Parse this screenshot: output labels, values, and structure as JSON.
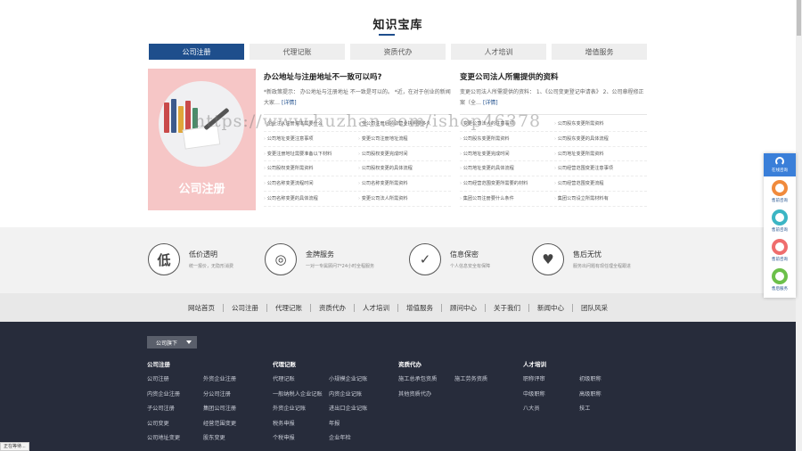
{
  "section": {
    "title": "知识宝库"
  },
  "tabs": [
    {
      "label": "公司注册",
      "active": true
    },
    {
      "label": "代理记账",
      "active": false
    },
    {
      "label": "资质代办",
      "active": false
    },
    {
      "label": "人才培训",
      "active": false
    },
    {
      "label": "增值服务",
      "active": false
    }
  ],
  "hero": {
    "label": "公司注册"
  },
  "articles": [
    {
      "title": "办公地址与注册地址不一致可以吗?",
      "summary": "*新政策提示： 办公地址与注册地址 不一致是可以的。 *近，在对于创业的新闻大家…",
      "more": "[详情]",
      "links": [
        "企业注入注册资本需要什么",
        "全公司注册后领取营业执照要多久",
        "公司地址变更注意事项",
        "变更公司注册地址流程",
        "变更注册地址需要准备以下材料",
        "公司股权变更完成时间",
        "公司股权变更所需资料",
        "公司股权变更的具体流程",
        "公司名称变更流程时间",
        "公司名称变更所需资料",
        "公司名称变更的具体流程",
        "变更公司法人所需资料"
      ]
    },
    {
      "title": "变更公司法人所需提供的资料",
      "summary": "变更公司法人所需提供的资料： 1、《公司变更登记申请表》 2、公司章程修正案（全…",
      "more": "[详情]",
      "links": [
        "变更公司法人的注意事项",
        "公司股东变更所需资料",
        "公司股东变更所需资料",
        "公司股东变更的具体流程",
        "公司地址变更完成时间",
        "公司地址变更所需资料",
        "公司地址变更的具体流程",
        "公司经营范围变更注意事项",
        "公司经营范围变更所需要的材料",
        "公司经营范围变更流程",
        "集团公司注册要什么条件",
        "集团公司设立所需材料有"
      ]
    }
  ],
  "watermark": "https://www.huzhan.com/ishop46378",
  "features": [
    {
      "icon": "低",
      "icon_name": "low-price-icon",
      "title": "低价透明",
      "sub": "统一报价，无隐形消费"
    },
    {
      "icon": "◎",
      "icon_name": "gold-service-icon",
      "title": "金牌服务",
      "sub": "一对一专属顾问7*24小时全程服务"
    },
    {
      "icon": "✓",
      "icon_name": "shield-icon",
      "title": "信息保密",
      "sub": "个人信息安全有保障"
    },
    {
      "icon": "♥",
      "icon_name": "heart-icon",
      "title": "售后无忧",
      "sub": "服务出问题有现任理全程跟进"
    }
  ],
  "nav": [
    "网站首页",
    "公司注册",
    "代理记账",
    "资质代办",
    "人才培训",
    "增值服务",
    "顾问中心",
    "关于我们",
    "新闻中心",
    "团队风采"
  ],
  "footer": {
    "dropdown": "公司旗下",
    "columns": [
      {
        "title": "公司注册",
        "items": [
          "公司注册",
          "外资企业注册",
          "内资企业注册",
          "分公司注册",
          "子公司注册",
          "集团公司注册",
          "公司变更",
          "经营范围变更",
          "公司地址变更",
          "股东变更"
        ]
      },
      {
        "title": "代理记账",
        "items": [
          "代理记账",
          "小规模企业记账",
          "一般纳税人企业记账",
          "内资企业记账",
          "外资企业记账",
          "进出口企业记账",
          "税务申报",
          "年报",
          "个税申报",
          "企业年检"
        ]
      },
      {
        "title": "资质代办",
        "items": [
          "施工总承包资质",
          "施工劳务资质",
          "其他资质代办"
        ]
      },
      {
        "title": "人才培训",
        "items": [
          "职称评审",
          "初级职称",
          "中级职称",
          "高级职称",
          "八大员",
          "技工"
        ]
      }
    ]
  },
  "float_bar": {
    "top_label": "在线咨询",
    "items": [
      {
        "label": "售前咨询",
        "color": "#f08a3c"
      },
      {
        "label": "售前咨询",
        "color": "#3bb5c4"
      },
      {
        "label": "售前咨询",
        "color": "#ef6d6d"
      },
      {
        "label": "售后服务",
        "color": "#6cc04a"
      }
    ]
  },
  "status": "正在等待..."
}
